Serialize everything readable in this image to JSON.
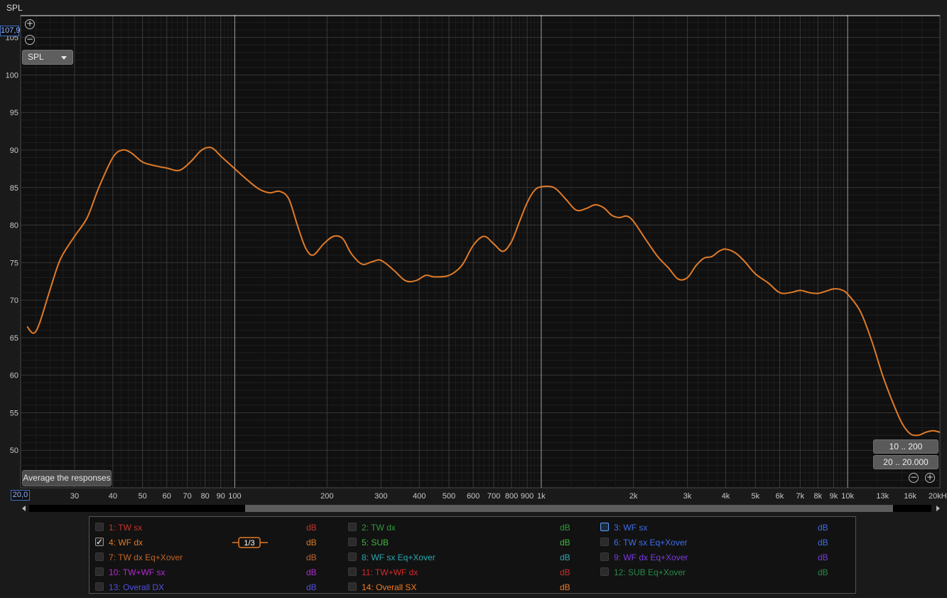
{
  "window": {
    "title": "SPL"
  },
  "controls": {
    "ymax_value": "107,9",
    "xmin_value": "20,0",
    "measurement_select": "SPL",
    "average_button": "Average the responses",
    "range_buttons": [
      "10 .. 200",
      "20 .. 20.000"
    ],
    "smoothing": "1/3"
  },
  "chart_data": {
    "type": "line",
    "xscale": "log",
    "xlim": [
      20,
      20000
    ],
    "ylim": [
      45,
      108
    ],
    "yticks": [
      50,
      55,
      60,
      65,
      70,
      75,
      80,
      85,
      90,
      95,
      100,
      105
    ],
    "xticks": [
      {
        "v": 30,
        "l": "30"
      },
      {
        "v": 40,
        "l": "40"
      },
      {
        "v": 50,
        "l": "50"
      },
      {
        "v": 60,
        "l": "60"
      },
      {
        "v": 70,
        "l": "70"
      },
      {
        "v": 80,
        "l": "80"
      },
      {
        "v": 90,
        "l": "90"
      },
      {
        "v": 100,
        "l": "100"
      },
      {
        "v": 200,
        "l": "200"
      },
      {
        "v": 300,
        "l": "300"
      },
      {
        "v": 400,
        "l": "400"
      },
      {
        "v": 500,
        "l": "500"
      },
      {
        "v": 600,
        "l": "600"
      },
      {
        "v": 700,
        "l": "700"
      },
      {
        "v": 800,
        "l": "800"
      },
      {
        "v": 900,
        "l": "900"
      },
      {
        "v": 1000,
        "l": "1k"
      },
      {
        "v": 2000,
        "l": "2k"
      },
      {
        "v": 3000,
        "l": "3k"
      },
      {
        "v": 4000,
        "l": "4k"
      },
      {
        "v": 5000,
        "l": "5k"
      },
      {
        "v": 6000,
        "l": "6k"
      },
      {
        "v": 7000,
        "l": "7k"
      },
      {
        "v": 8000,
        "l": "8k"
      },
      {
        "v": 9000,
        "l": "9k"
      },
      {
        "v": 10000,
        "l": "10k"
      },
      {
        "v": 13000,
        "l": "13k"
      },
      {
        "v": 16000,
        "l": "16k"
      },
      {
        "v": 20000,
        "l": "20kHz"
      }
    ],
    "cursor_level": 107.9,
    "series": [
      {
        "name": "4: WF dx",
        "color": "#e07b28",
        "points": [
          [
            21,
            66.5
          ],
          [
            22,
            65.6
          ],
          [
            23,
            66.8
          ],
          [
            25,
            71.5
          ],
          [
            27,
            75.5
          ],
          [
            30,
            78.5
          ],
          [
            33,
            81
          ],
          [
            36,
            85
          ],
          [
            40,
            89
          ],
          [
            43,
            90
          ],
          [
            46,
            89.6
          ],
          [
            50,
            88.4
          ],
          [
            55,
            87.9
          ],
          [
            60,
            87.6
          ],
          [
            66,
            87.3
          ],
          [
            72,
            88.5
          ],
          [
            78,
            90
          ],
          [
            84,
            90.3
          ],
          [
            90,
            89.2
          ],
          [
            100,
            87.5
          ],
          [
            110,
            86
          ],
          [
            120,
            84.8
          ],
          [
            130,
            84.3
          ],
          [
            140,
            84.5
          ],
          [
            150,
            83.5
          ],
          [
            160,
            80
          ],
          [
            170,
            77
          ],
          [
            180,
            76
          ],
          [
            195,
            77.5
          ],
          [
            210,
            78.5
          ],
          [
            225,
            78.2
          ],
          [
            240,
            76.2
          ],
          [
            260,
            74.8
          ],
          [
            280,
            75.1
          ],
          [
            300,
            75.3
          ],
          [
            330,
            74
          ],
          [
            360,
            72.6
          ],
          [
            390,
            72.6
          ],
          [
            420,
            73.3
          ],
          [
            450,
            73.1
          ],
          [
            500,
            73.3
          ],
          [
            550,
            74.6
          ],
          [
            600,
            77.3
          ],
          [
            650,
            78.5
          ],
          [
            700,
            77.5
          ],
          [
            750,
            76.5
          ],
          [
            800,
            77.8
          ],
          [
            850,
            80.5
          ],
          [
            900,
            83
          ],
          [
            950,
            84.6
          ],
          [
            1000,
            85.1
          ],
          [
            1100,
            85
          ],
          [
            1200,
            83.5
          ],
          [
            1300,
            82
          ],
          [
            1400,
            82.2
          ],
          [
            1500,
            82.7
          ],
          [
            1600,
            82.3
          ],
          [
            1700,
            81.3
          ],
          [
            1800,
            81
          ],
          [
            1900,
            81.2
          ],
          [
            2000,
            80.5
          ],
          [
            2200,
            78
          ],
          [
            2400,
            75.8
          ],
          [
            2600,
            74.3
          ],
          [
            2800,
            72.8
          ],
          [
            3000,
            73
          ],
          [
            3200,
            74.6
          ],
          [
            3400,
            75.6
          ],
          [
            3600,
            75.8
          ],
          [
            3800,
            76.5
          ],
          [
            4000,
            76.8
          ],
          [
            4300,
            76.3
          ],
          [
            4600,
            75.2
          ],
          [
            5000,
            73.5
          ],
          [
            5500,
            72.3
          ],
          [
            6000,
            71
          ],
          [
            6500,
            71
          ],
          [
            7000,
            71.3
          ],
          [
            7500,
            71
          ],
          [
            8000,
            70.9
          ],
          [
            8500,
            71.2
          ],
          [
            9000,
            71.5
          ],
          [
            9500,
            71.4
          ],
          [
            10000,
            70.8
          ],
          [
            11000,
            68.5
          ],
          [
            12000,
            64.5
          ],
          [
            13000,
            60
          ],
          [
            14000,
            56.5
          ],
          [
            15000,
            53.7
          ],
          [
            16000,
            52.2
          ],
          [
            17000,
            52
          ],
          [
            18000,
            52.4
          ],
          [
            19000,
            52.6
          ],
          [
            20000,
            52.4
          ]
        ]
      }
    ]
  },
  "legend": {
    "items": [
      {
        "label": "1: TW sx",
        "unit": "dB",
        "color": "#c8322a",
        "checked": false
      },
      {
        "label": "2: TW dx",
        "unit": "dB",
        "color": "#2e9a3a",
        "checked": false
      },
      {
        "label": "3: WF sx",
        "unit": "dB",
        "color": "#3f6ee8",
        "checked": false
      },
      {
        "label": "4: WF dx",
        "unit": "dB",
        "color": "#e07b28",
        "checked": true
      },
      {
        "label": "5: SUB",
        "unit": "dB",
        "color": "#3fb83f",
        "checked": false
      },
      {
        "label": "6: TW sx Eq+Xover",
        "unit": "dB",
        "color": "#3f6ee8",
        "checked": false
      },
      {
        "label": "7: TW dx Eq+Xover",
        "unit": "dB",
        "color": "#c0642a",
        "checked": false
      },
      {
        "label": "8: WF sx Eq+Xover",
        "unit": "dB",
        "color": "#2aa7b0",
        "checked": false
      },
      {
        "label": "9: WF dx Eq+Xover",
        "unit": "dB",
        "color": "#7a3ae0",
        "checked": false
      },
      {
        "label": "10: TW+WF sx",
        "unit": "dB",
        "color": "#b22ad0",
        "checked": false
      },
      {
        "label": "11: TW+WF dx",
        "unit": "dB",
        "color": "#d02a2a",
        "checked": false
      },
      {
        "label": "12: SUB Eq+Xover",
        "unit": "dB",
        "color": "#2a8a4a",
        "checked": false
      },
      {
        "label": "13: Overall DX",
        "unit": "dB",
        "color": "#5050e0",
        "checked": false
      },
      {
        "label": "14: Overall SX",
        "unit": "dB",
        "color": "#f07a20",
        "checked": false
      }
    ]
  }
}
